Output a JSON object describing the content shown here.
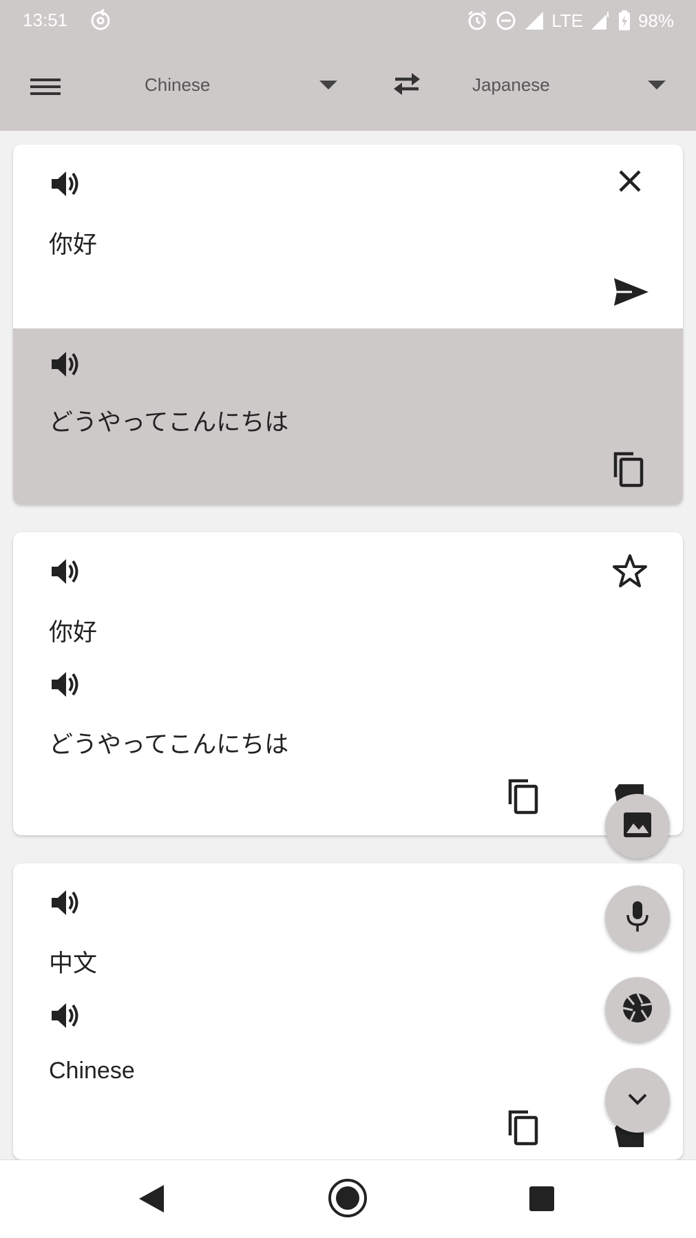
{
  "status_bar": {
    "time": "13:51",
    "network": "LTE",
    "battery": "98%",
    "icons": [
      "sync-icon",
      "alarm-icon",
      "do-not-disturb-icon",
      "signal-icon",
      "signal-icon",
      "battery-charging-icon"
    ]
  },
  "toolbar": {
    "source_language": "Chinese",
    "target_language": "Japanese",
    "icons": [
      "menu-icon",
      "dropdown-icon",
      "swap-icon",
      "dropdown-icon"
    ]
  },
  "input_card": {
    "source_text": "你好",
    "translated_text": "どうやってこんにちは",
    "icons": [
      "speaker-icon",
      "close-icon",
      "send-icon",
      "speaker-icon",
      "copy-icon"
    ]
  },
  "history": [
    {
      "source_text": "你好",
      "translated_text": "どうやってこんにちは",
      "icons": [
        "speaker-icon",
        "star-icon",
        "speaker-icon",
        "copy-icon",
        "delete-icon"
      ]
    },
    {
      "source_text": "中文",
      "translated_text": "Chinese",
      "icons": [
        "speaker-icon",
        "speaker-icon",
        "copy-icon",
        "delete-icon"
      ]
    }
  ],
  "fabs": [
    "image-icon",
    "mic-icon",
    "camera-icon",
    "chevron-down-icon"
  ],
  "nav_bar": [
    "back-icon",
    "home-icon",
    "recents-icon"
  ],
  "colors": {
    "toolbar_bg": "#cdc9c9",
    "background": "#f2f1f1",
    "card_bg": "#ffffff",
    "icon": "#222222",
    "text_secondary": "#555555"
  }
}
